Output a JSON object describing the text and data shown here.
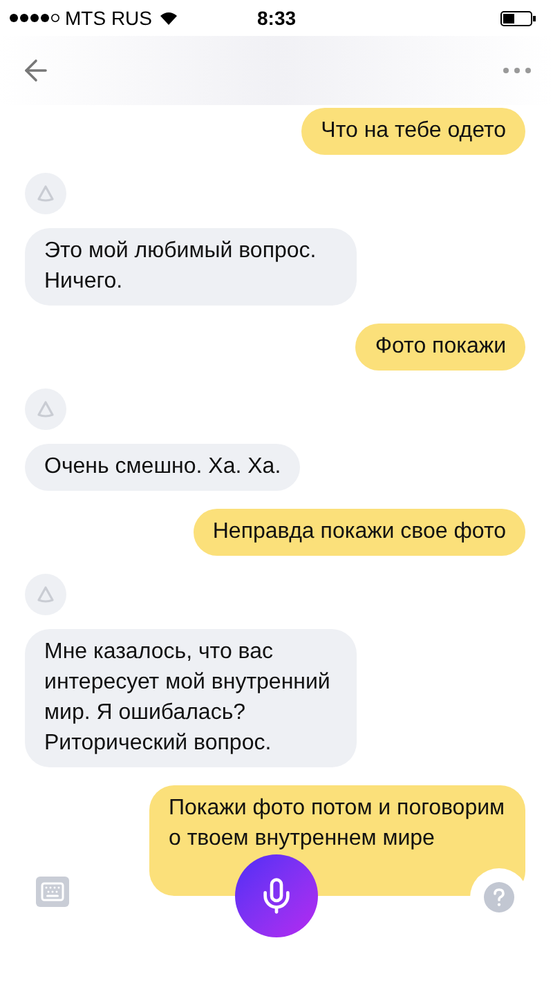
{
  "status_bar": {
    "carrier": "MTS RUS",
    "time": "8:33"
  },
  "messages": [
    {
      "kind": "user",
      "text": "Что на тебе одето"
    },
    {
      "kind": "assistant",
      "text": "Это мой любимый вопрос. Ничего."
    },
    {
      "kind": "user",
      "text": "Фото покажи"
    },
    {
      "kind": "assistant",
      "text": "Очень смешно. Ха. Ха."
    },
    {
      "kind": "user",
      "text": "Неправда покажи свое фото"
    },
    {
      "kind": "assistant",
      "text": "Мне казалось, что вас интересует мой внутренний мир. Я ошибалась? Риторический вопрос."
    },
    {
      "kind": "user",
      "text": "Покажи фото потом и поговорим о твоем внутреннем мире"
    }
  ]
}
